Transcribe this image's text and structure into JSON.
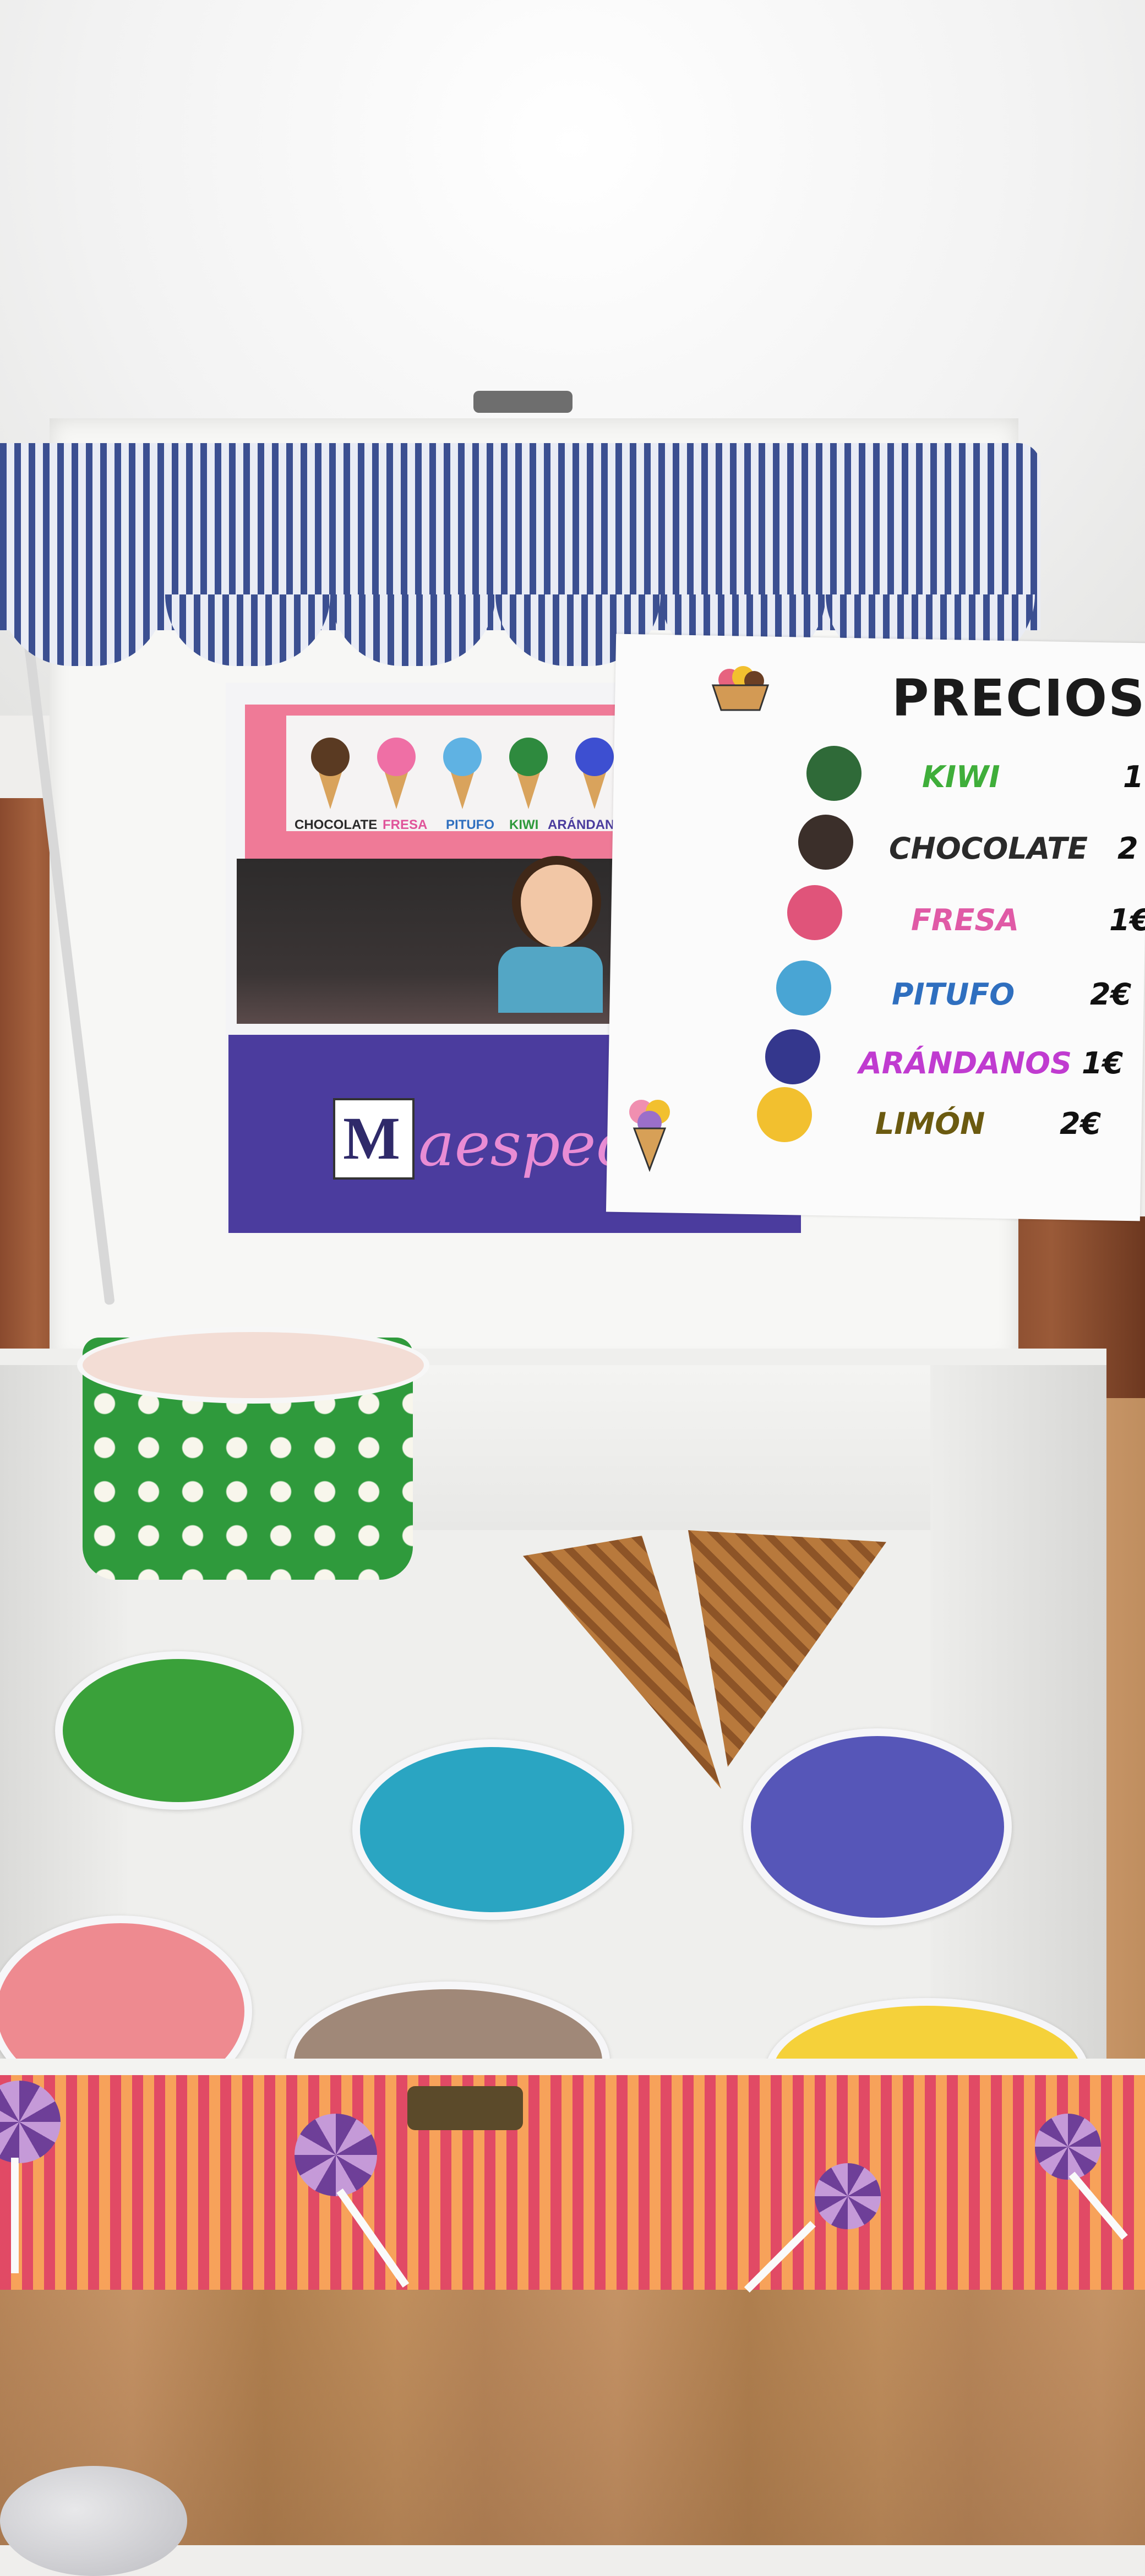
{
  "scene": "ice-cream-shop",
  "poster": {
    "flavor_labels": [
      "CHOCOLATE",
      "FRESA",
      "PITUFO",
      "KIWI",
      "ARÁNDANOS"
    ],
    "logo_letter": "M",
    "brand_text": "aespeci"
  },
  "price_sign": {
    "title": "PRECIOS",
    "items": [
      {
        "flavor": "KIWI",
        "price": "1",
        "dot_color": "#2f6a38",
        "text_color": "#3fae3a"
      },
      {
        "flavor": "CHOCOLATE",
        "price": "2",
        "dot_color": "#3b2f2a",
        "text_color": "#2a2a2a"
      },
      {
        "flavor": "FRESA",
        "price": "1€",
        "dot_color": "#e0547a",
        "text_color": "#e05aa6"
      },
      {
        "flavor": "PITUFO",
        "price": "2€",
        "dot_color": "#49a5d4",
        "text_color": "#2f6fbf"
      },
      {
        "flavor": "ARÁNDANOS",
        "price": "1€",
        "dot_color": "#34378d",
        "text_color": "#c03bd0"
      },
      {
        "flavor": "LIMÓN",
        "price": "2€",
        "dot_color": "#f2c02f",
        "text_color": "#6b5a10"
      }
    ]
  },
  "colors": {
    "awning_blue": "#3b4f91",
    "poster_pink": "#ef7a97",
    "poster_purple": "#4b3c9e",
    "box_stripe_red": "#e14a65",
    "box_stripe_orange": "#f7a25a",
    "cup_green": "#2f9a3c"
  },
  "discs": [
    {
      "name": "green-disc",
      "color": "#3aa13a"
    },
    {
      "name": "blue-disc",
      "color": "#2aa5c2"
    },
    {
      "name": "purple-disc",
      "color": "#5656b8"
    },
    {
      "name": "pink-disc",
      "color": "#ee8a90"
    },
    {
      "name": "brown-disc",
      "color": "#a08878"
    },
    {
      "name": "yellow-disc",
      "color": "#f5d13a"
    }
  ]
}
